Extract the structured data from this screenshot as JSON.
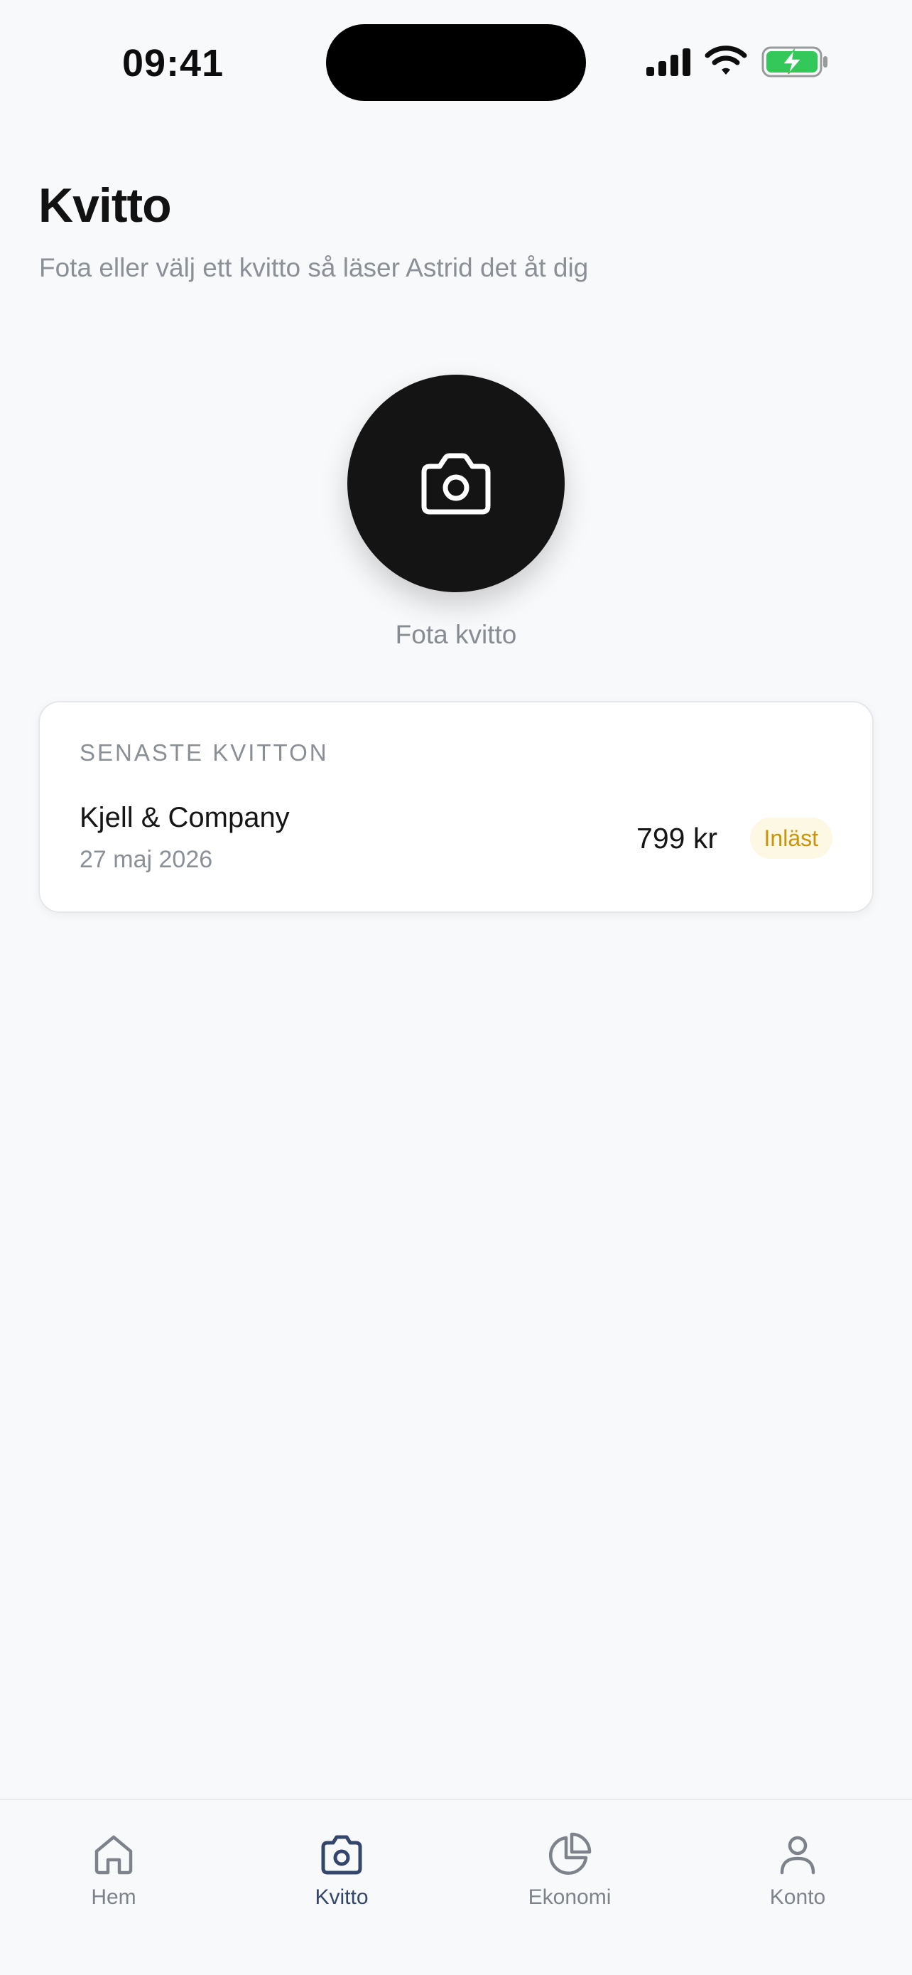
{
  "status_bar": {
    "time": "09:41"
  },
  "header": {
    "title": "Kvitto",
    "subtitle": "Fota eller välj ett kvitto så läser Astrid det åt dig"
  },
  "capture": {
    "icon": "camera-icon",
    "label": "Fota kvitto"
  },
  "recent_receipts": {
    "heading": "SENASTE KVITTON",
    "items": [
      {
        "merchant": "Kjell & Company",
        "date": "27 maj 2026",
        "amount": "799 kr",
        "status": "Inläst"
      }
    ]
  },
  "tab_bar": {
    "active": "Kvitto",
    "tabs": [
      {
        "label": "Hem",
        "icon": "home-icon"
      },
      {
        "label": "Kvitto",
        "icon": "camera-icon"
      },
      {
        "label": "Ekonomi",
        "icon": "pie-chart-icon"
      },
      {
        "label": "Konto",
        "icon": "user-icon"
      }
    ]
  },
  "colors": {
    "background": "#f8f9fb",
    "camera_button": "#141414",
    "active_tab": "#34466b",
    "inactive_tab": "#7e838b",
    "badge_bg": "#fdf8e3",
    "badge_text": "#c9930a",
    "battery": "#34c759"
  }
}
